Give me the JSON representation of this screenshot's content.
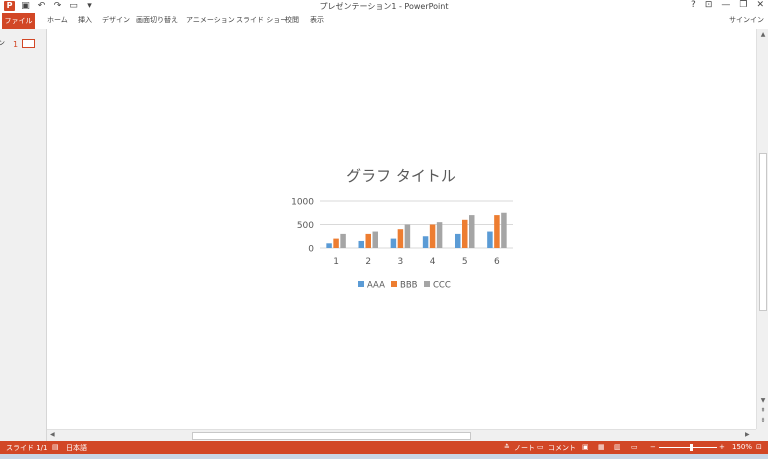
{
  "window": {
    "title": "プレゼンテーション1 - PowerPoint",
    "logo": "P",
    "help": "?",
    "restore_ribbon": "⊡",
    "minimize": "—",
    "maximize": "❐",
    "close": "✕"
  },
  "ribbon": {
    "file_tab": "ファイル",
    "tabs": [
      "ホーム",
      "挿入",
      "デザイン",
      "画面切り替え",
      "アニメーション",
      "スライド ショー",
      "校閲",
      "表示"
    ],
    "signin": "サインイン"
  },
  "thumbnails": {
    "label_fragment": "ン",
    "items": [
      {
        "number": "1"
      }
    ]
  },
  "statusbar": {
    "slide_info": "スライド 1/1",
    "language": "日本語",
    "notes": "ノート",
    "comments": "コメント",
    "zoom_minus": "−",
    "zoom_plus": "+",
    "zoom_level": "150%",
    "zoom_fraction": 0.55
  },
  "colors": {
    "accent": "#d24726",
    "series": [
      "#5b9bd5",
      "#ed7d31",
      "#a5a5a5"
    ]
  },
  "chart_data": {
    "type": "bar",
    "title": "グラフ タイトル",
    "categories": [
      "1",
      "2",
      "3",
      "4",
      "5",
      "6"
    ],
    "series": [
      {
        "name": "AAA",
        "values": [
          100,
          150,
          200,
          250,
          300,
          350
        ]
      },
      {
        "name": "BBB",
        "values": [
          200,
          300,
          400,
          500,
          600,
          700
        ]
      },
      {
        "name": "CCC",
        "values": [
          300,
          350,
          500,
          550,
          700,
          750
        ]
      }
    ],
    "ylim": [
      0,
      1000
    ],
    "yticks": [
      "0",
      "500",
      "1000"
    ],
    "grid": true,
    "legend_position": "bottom"
  }
}
